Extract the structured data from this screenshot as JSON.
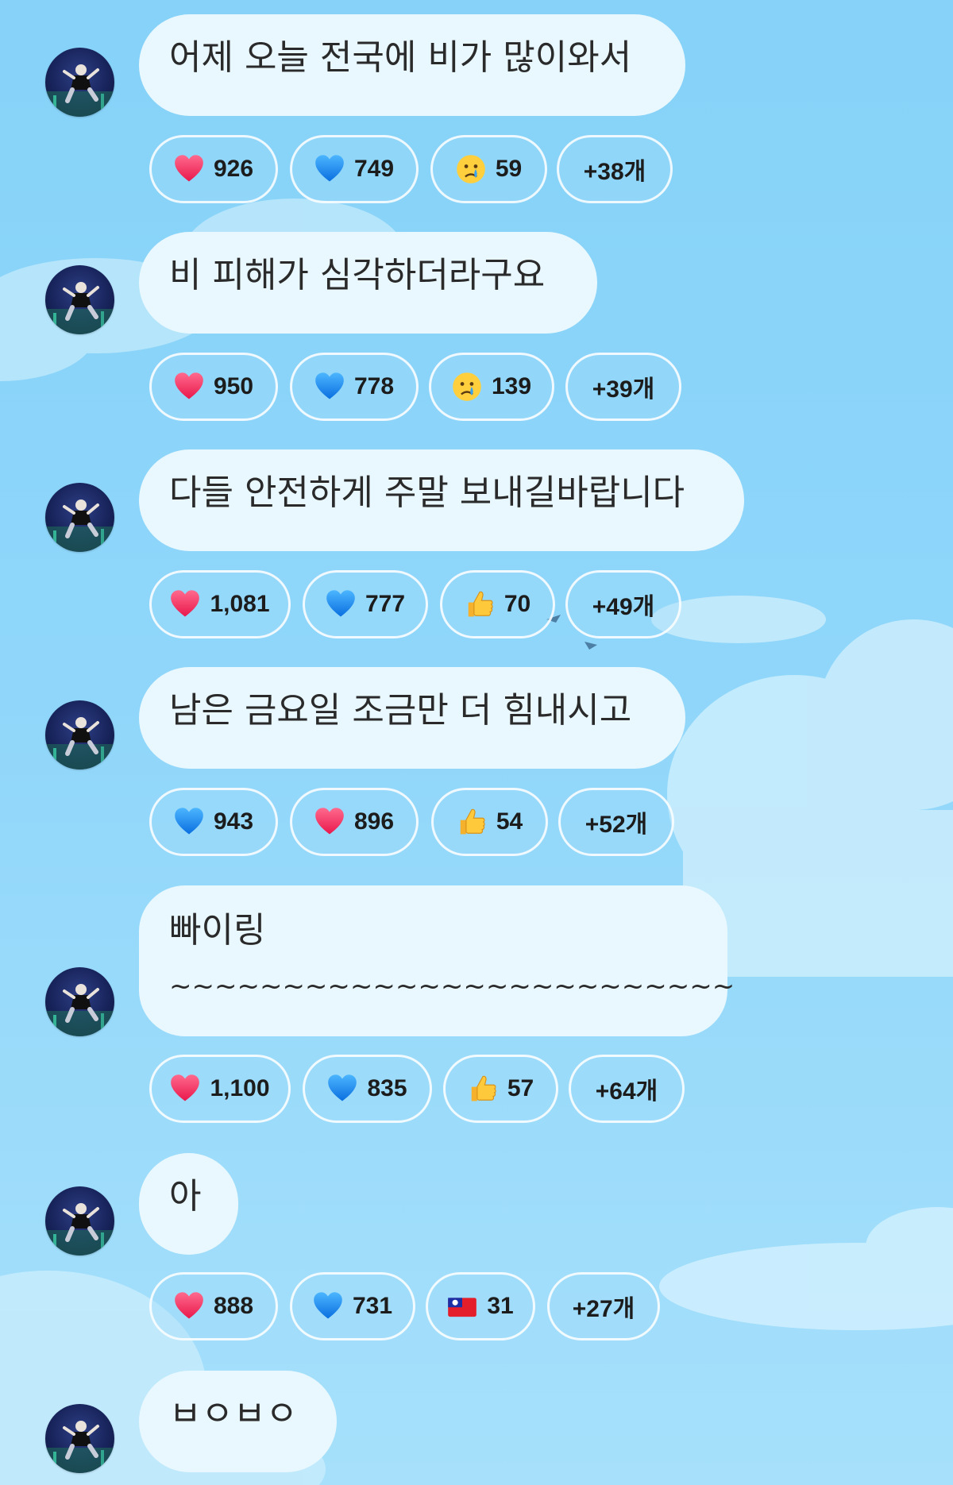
{
  "messages": [
    {
      "text": "어제 오늘 전국에 비가 많이와서",
      "reactions": [
        {
          "icon": "red-heart-icon",
          "count": "926"
        },
        {
          "icon": "blue-heart-icon",
          "count": "749"
        },
        {
          "icon": "crying-face-icon",
          "count": "59"
        },
        {
          "more": "+38개"
        }
      ]
    },
    {
      "text": "비 피해가 심각하더라구요",
      "reactions": [
        {
          "icon": "red-heart-icon",
          "count": "950"
        },
        {
          "icon": "blue-heart-icon",
          "count": "778"
        },
        {
          "icon": "crying-face-icon",
          "count": "139"
        },
        {
          "more": "+39개"
        }
      ]
    },
    {
      "text": "다들 안전하게 주말 보내길바랍니다",
      "reactions": [
        {
          "icon": "red-heart-icon",
          "count": "1,081"
        },
        {
          "icon": "blue-heart-icon",
          "count": "777"
        },
        {
          "icon": "thumbs-up-icon",
          "count": "70"
        },
        {
          "more": "+49개"
        }
      ]
    },
    {
      "text": "남은 금요일 조금만 더 힘내시고",
      "reactions": [
        {
          "icon": "blue-heart-icon",
          "count": "943"
        },
        {
          "icon": "red-heart-icon",
          "count": "896"
        },
        {
          "icon": "thumbs-up-icon",
          "count": "54"
        },
        {
          "more": "+52개"
        }
      ]
    },
    {
      "text_line1": "빠이링",
      "text_line2": "~~~~~~~~~~~~~~~~~~~~~~~~~",
      "reactions": [
        {
          "icon": "red-heart-icon",
          "count": "1,100"
        },
        {
          "icon": "blue-heart-icon",
          "count": "835"
        },
        {
          "icon": "thumbs-up-icon",
          "count": "57"
        },
        {
          "more": "+64개"
        }
      ]
    },
    {
      "text": "아",
      "reactions": [
        {
          "icon": "red-heart-icon",
          "count": "888"
        },
        {
          "icon": "blue-heart-icon",
          "count": "731"
        },
        {
          "icon": "taiwan-flag-icon",
          "count": "31"
        },
        {
          "more": "+27개"
        }
      ]
    },
    {
      "text": "ㅂㅇㅂㅇ"
    }
  ]
}
